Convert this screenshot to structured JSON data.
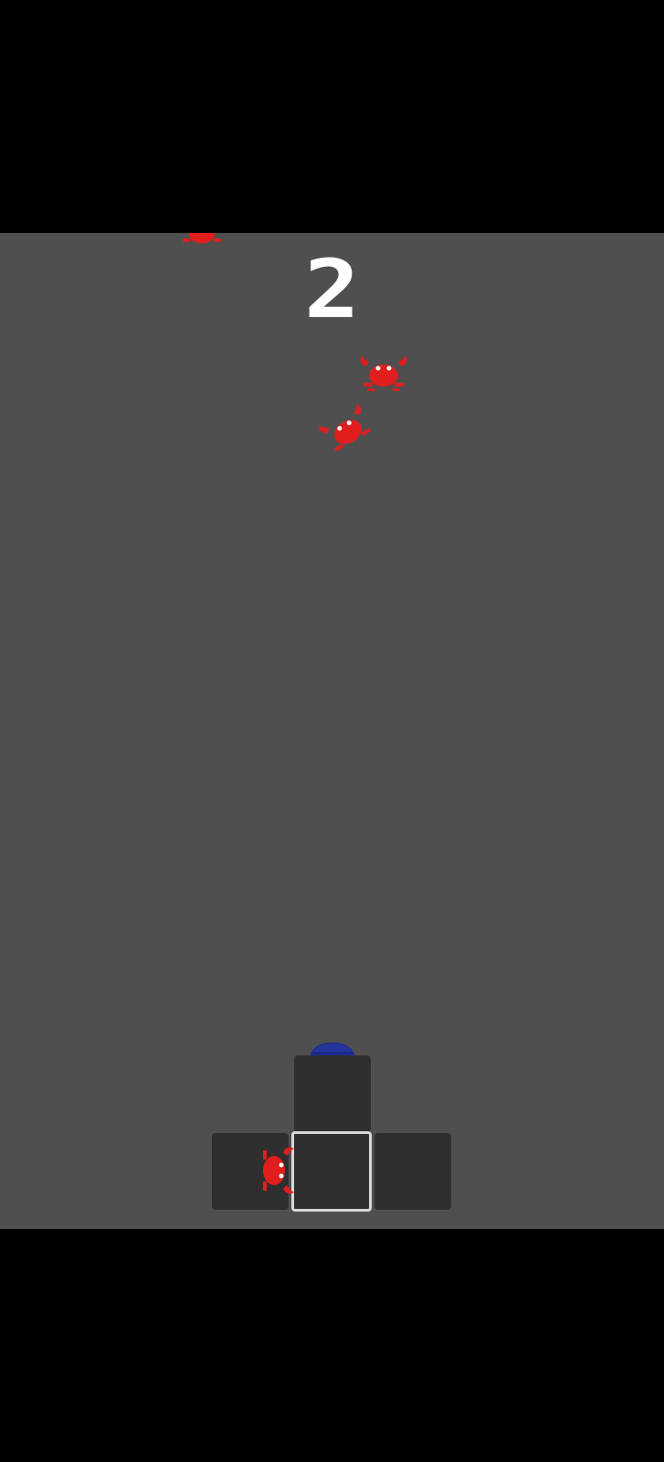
{
  "game": {
    "score": "2",
    "colors": {
      "background": "#4f4f4f",
      "letterbox": "#000000",
      "score_text": "#ffffff",
      "crab": "#e01e1e",
      "tile": "#2f2f2f",
      "tile_selected_border": "#d8d8d8"
    },
    "sprites": {
      "enemy": "crab-icon",
      "player": "caveman-character"
    },
    "lanes": [
      "left",
      "center",
      "right"
    ],
    "selected_lane": "center",
    "crab_count": 4
  }
}
